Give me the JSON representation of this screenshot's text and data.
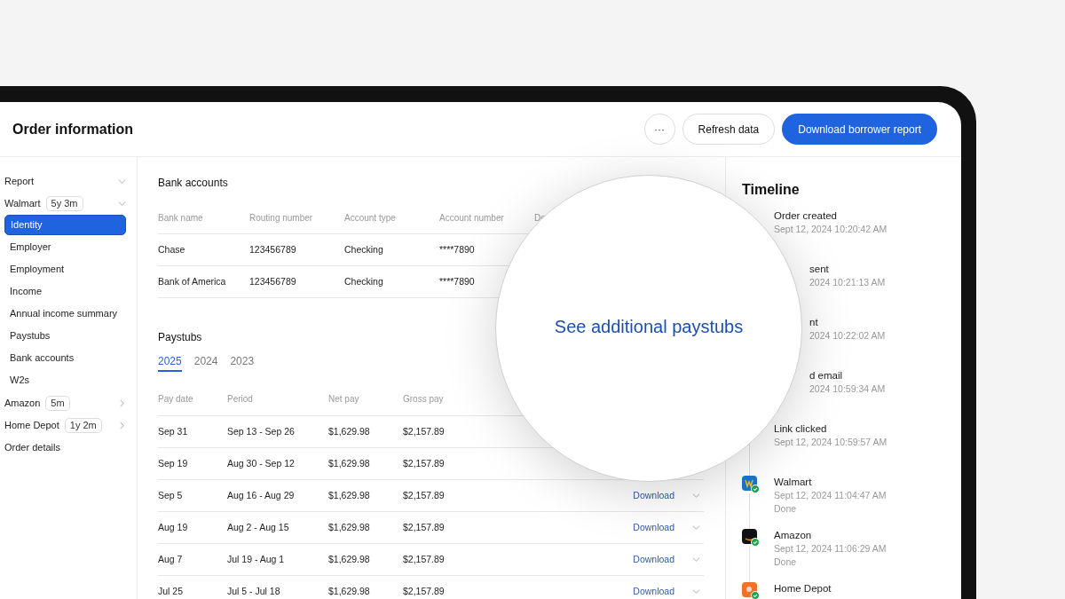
{
  "header": {
    "title": "Order information",
    "more_button": "···",
    "buttons": [
      "Refresh data",
      "Download borrower report"
    ]
  },
  "sidebar": {
    "items": [
      {
        "label": "Report",
        "kind": "group",
        "expanded": true
      },
      {
        "label": "Walmart",
        "badge": "5y 3m",
        "kind": "group",
        "expanded": true,
        "children": [
          {
            "label": "Identity",
            "selected": true
          },
          {
            "label": "Employer",
            "selected": false
          },
          {
            "label": "Employment",
            "selected": false
          },
          {
            "label": "Income",
            "selected": false
          },
          {
            "label": "Annual income summary",
            "selected": false
          },
          {
            "label": "Paystubs",
            "selected": false
          },
          {
            "label": "Bank accounts",
            "selected": false
          },
          {
            "label": "W2s",
            "selected": false
          }
        ]
      },
      {
        "label": "Amazon",
        "badge": "5m",
        "kind": "group",
        "expanded": false
      },
      {
        "label": "Home Depot",
        "badge": "1y 2m",
        "kind": "group",
        "expanded": false
      },
      {
        "label": "Order details",
        "kind": "link"
      }
    ]
  },
  "bank_accounts": {
    "title": "Bank accounts",
    "columns": [
      "Bank name",
      "Routing number",
      "Account type",
      "Account number",
      "De"
    ],
    "rows": [
      [
        "Chase",
        "123456789",
        "Checking",
        "****7890"
      ],
      [
        "Bank of America",
        "123456789",
        "Checking",
        "****7890"
      ]
    ]
  },
  "paystubs": {
    "title": "Paystubs",
    "tabs": [
      {
        "label": "2025",
        "selected": true
      },
      {
        "label": "2024",
        "selected": false
      },
      {
        "label": "2023",
        "selected": false
      }
    ],
    "columns": [
      "Pay date",
      "Period",
      "Net pay",
      "Gross pay"
    ],
    "rows": [
      {
        "cells": [
          "Sep 31",
          "Sep 13 - Sep 26",
          "$1,629.98",
          "$2,157.89"
        ]
      },
      {
        "cells": [
          "Sep 19",
          "Aug 30 - Sep 12",
          "$1,629.98",
          "$2,157.89"
        ]
      },
      {
        "cells": [
          "Sep 5",
          "Aug 16 - Aug 29",
          "$1,629.98",
          "$2,157.89"
        ],
        "link": "Download"
      },
      {
        "cells": [
          "Aug 19",
          "Aug 2 - Aug 15",
          "$1,629.98",
          "$2,157.89"
        ],
        "link": "Download"
      },
      {
        "cells": [
          "Aug 7",
          "Jul 19 - Aug 1",
          "$1,629.98",
          "$2,157.89"
        ],
        "link": "Download"
      },
      {
        "cells": [
          "Jul 25",
          "Jul 5 - Jul 18",
          "$1,629.98",
          "$2,157.89"
        ],
        "link": "Download"
      }
    ]
  },
  "magnifier": {
    "link": "See additional paystubs"
  },
  "timeline": {
    "title": "Timeline",
    "events": [
      {
        "kind": "plain",
        "title": "Order created",
        "time": "Sept 12, 2024 10:20:42 AM"
      },
      {
        "kind": "partial",
        "title": "sent",
        "time": "2024 10:21:13 AM"
      },
      {
        "kind": "partial",
        "title": "nt",
        "time": "2024 10:22:02 AM"
      },
      {
        "kind": "partial",
        "title": "d email",
        "time": "2024 10:59:34 AM"
      },
      {
        "kind": "plain",
        "title": "Link clicked",
        "time": "Sept 12, 2024 10:59:57 AM"
      },
      {
        "kind": "walmart",
        "title": "Walmart",
        "time": "Sept 12, 2024 11:04:47 AM",
        "status": "Done"
      },
      {
        "kind": "amazon",
        "title": "Amazon",
        "time": "Sept 12, 2024 11:06:29 AM",
        "status": "Done"
      },
      {
        "kind": "homedepot",
        "title": "Home Depot"
      }
    ]
  }
}
